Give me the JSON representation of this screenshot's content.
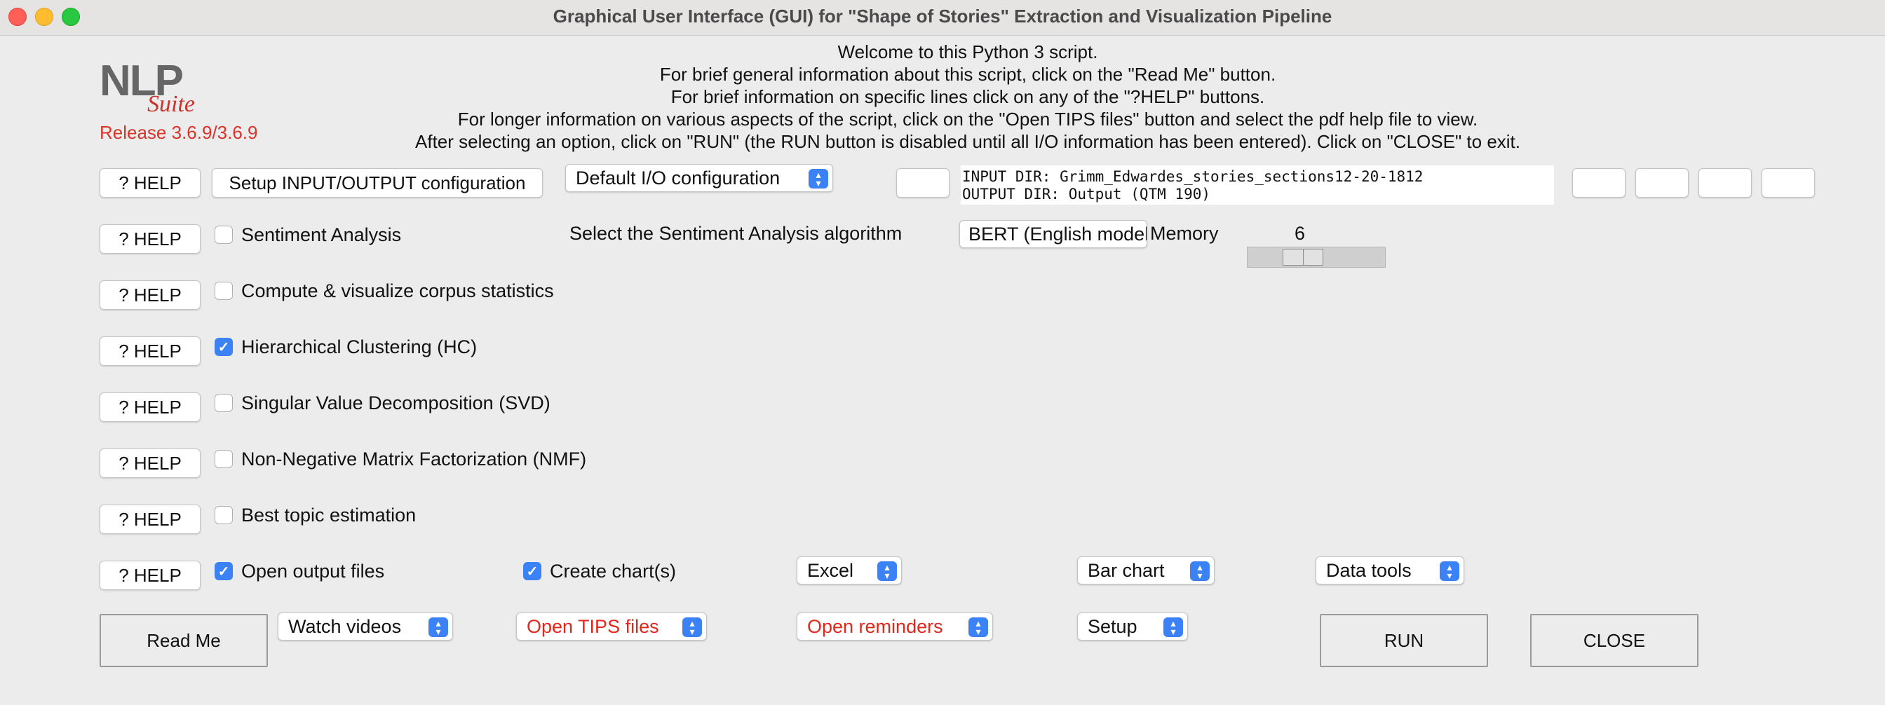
{
  "window": {
    "title": "Graphical User Interface (GUI) for \"Shape of Stories\" Extraction and Visualization Pipeline"
  },
  "logo": {
    "nlp": "NLP",
    "suite": "Suite",
    "release": "Release 3.6.9/3.6.9"
  },
  "welcome": [
    "Welcome to this Python 3 script.",
    "For brief general information about this script, click on the \"Read Me\" button.",
    "For brief information on specific lines click on any of the \"?HELP\" buttons.",
    "For longer information on various aspects of the script, click on the \"Open TIPS files\" button and select the pdf help file to view.",
    "After selecting an option, click on \"RUN\" (the RUN button is disabled until all I/O information has been entered).   Click on \"CLOSE\" to exit."
  ],
  "help_label": "? HELP",
  "io": {
    "setup_button": "Setup INPUT/OUTPUT configuration",
    "config_select": "Default I/O configuration",
    "input_dir": "INPUT DIR: Grimm_Edwardes_stories_sections12-20-1812",
    "output_dir": "OUTPUT DIR: Output (QTM 190)"
  },
  "sentiment": {
    "label": "Sentiment Analysis",
    "checked": false,
    "algo_label": "Select the Sentiment Analysis algorithm",
    "algo_value": "BERT (English model)",
    "memory_label": "Memory",
    "memory_value": "6"
  },
  "options": [
    {
      "label": "Compute & visualize corpus statistics",
      "checked": false
    },
    {
      "label": "Hierarchical Clustering (HC)",
      "checked": true
    },
    {
      "label": "Singular Value Decomposition (SVD)",
      "checked": false
    },
    {
      "label": "Non-Negative Matrix Factorization (NMF)",
      "checked": false
    },
    {
      "label": "Best topic estimation",
      "checked": false
    }
  ],
  "output": {
    "open_files_label": "Open output files",
    "open_files_checked": true,
    "create_charts_label": "Create chart(s)",
    "create_charts_checked": true,
    "chart_package": "Excel",
    "chart_type": "Bar chart",
    "data_tools": "Data tools"
  },
  "bottom": {
    "read_me": "Read Me",
    "watch_videos": "Watch videos",
    "open_tips": "Open TIPS files",
    "open_reminders": "Open reminders",
    "setup": "Setup",
    "run": "RUN",
    "close": "CLOSE"
  }
}
